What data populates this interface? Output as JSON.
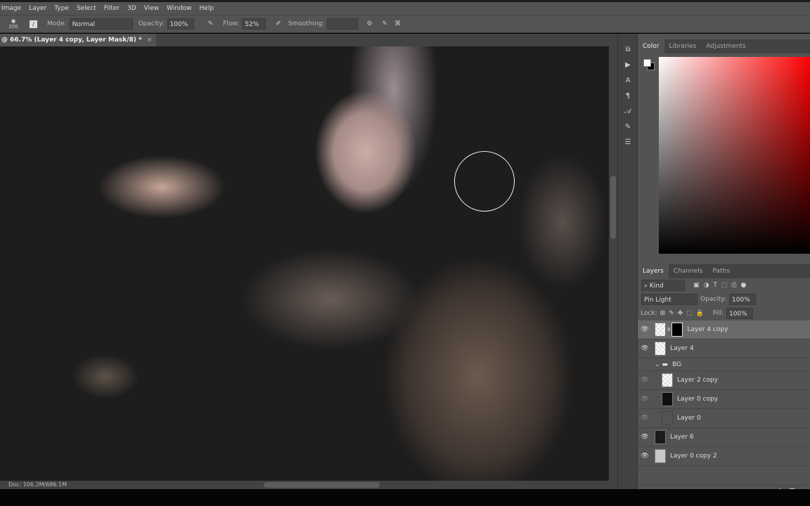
{
  "menu": [
    "Image",
    "Layer",
    "Type",
    "Select",
    "Filter",
    "3D",
    "View",
    "Window",
    "Help"
  ],
  "options": {
    "brush_size": "200",
    "mode_label": "Mode:",
    "mode": "Normal",
    "opacity_label": "Opacity:",
    "opacity": "100%",
    "flow_label": "Flow:",
    "flow": "52%",
    "smoothing_label": "Smoothing:",
    "smoothing": ""
  },
  "doc": {
    "title": "@ 66.7% (Layer 4 copy, Layer Mask/8) *",
    "close": "×"
  },
  "status": "Doc: 106.2M/686.1M",
  "color_panel": {
    "tabs": [
      "Color",
      "Libraries",
      "Adjustments"
    ]
  },
  "layers_panel": {
    "tabs": [
      "Layers",
      "Channels",
      "Paths"
    ],
    "filter": "Kind",
    "blend": "Pin Light",
    "opacity_label": "Opacity:",
    "opacity": "100%",
    "lock_label": "Lock:",
    "fill_label": "Fill:",
    "fill": "100%",
    "layers": [
      {
        "name": "Layer 4 copy",
        "visible": true,
        "selected": true
      },
      {
        "name": "Layer 4",
        "visible": true
      },
      {
        "name": "BG",
        "visible": false,
        "group": true
      },
      {
        "name": "Layer 2 copy",
        "visible": true
      },
      {
        "name": "Layer 0 copy",
        "visible": true
      },
      {
        "name": "Layer 0",
        "visible": true
      },
      {
        "name": "Layer 6",
        "visible": true
      },
      {
        "name": "Layer 0 copy 2",
        "visible": true
      }
    ]
  }
}
